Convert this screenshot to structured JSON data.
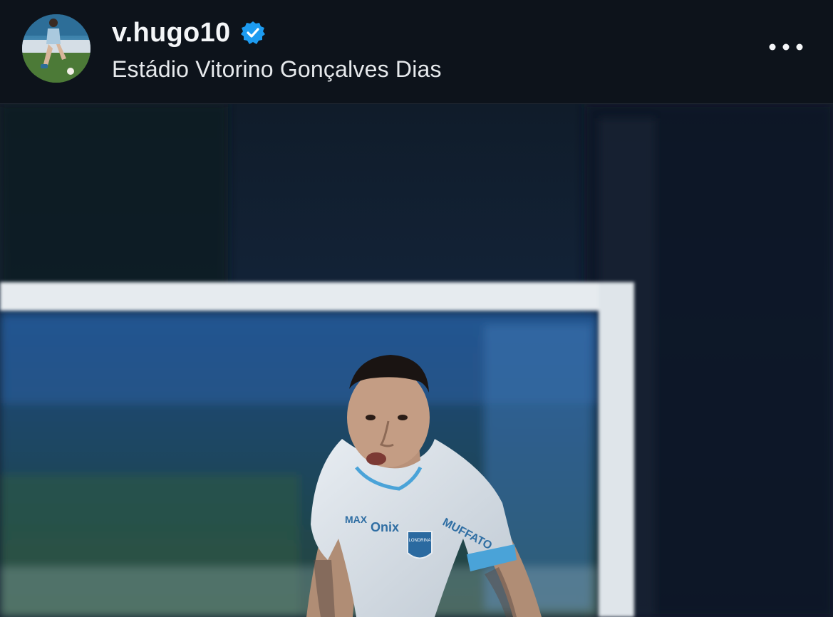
{
  "post_header": {
    "username": "v.hugo10",
    "verified": true,
    "location": "Estádio Vitorino Gonçalves Dias",
    "avatar_icon": "profile-avatar-player",
    "more_icon": "more-horizontal-icon"
  },
  "post_image": {
    "description_icon": "football-player-photo",
    "jersey_texts": [
      "MAX",
      "Onix",
      "LONDRINA",
      "MUFFATO"
    ]
  },
  "colors": {
    "header_bg": "#0d131b",
    "text": "#f4f6f8",
    "verified_blue": "#1d9bf0"
  }
}
